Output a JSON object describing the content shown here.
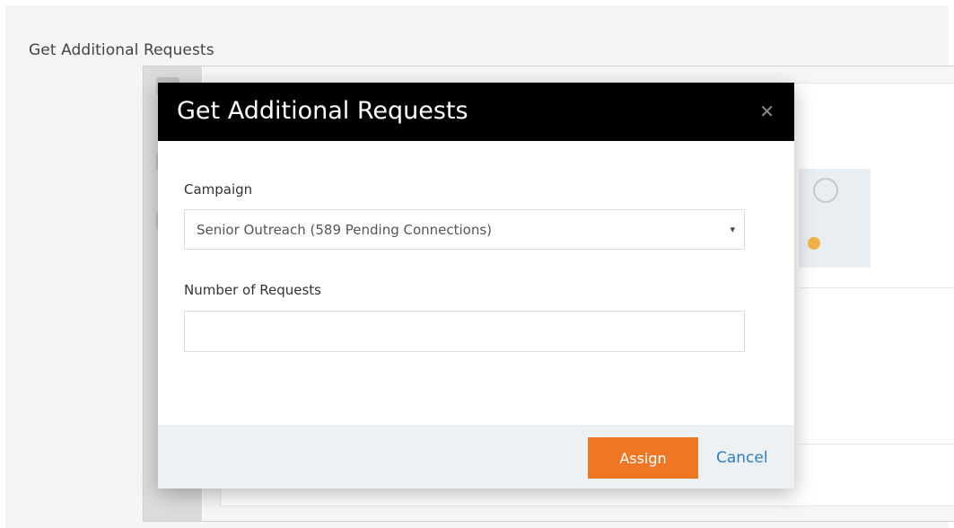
{
  "page": {
    "heading": "Get Additional Requests"
  },
  "modal": {
    "title": "Get Additional Requests",
    "close_icon": "close-icon",
    "campaign": {
      "label": "Campaign",
      "selected": "Senior Outreach (589 Pending Connections)",
      "caret_icon": "caret-down-icon"
    },
    "requests": {
      "label": "Number of Requests",
      "value": "",
      "placeholder": ""
    },
    "footer": {
      "assign_label": "Assign",
      "cancel_label": "Cancel"
    }
  },
  "colors": {
    "header_bg": "#000000",
    "assign_bg": "#ee7625",
    "cancel_link": "#2c7fc0",
    "footer_bg": "#edf1f4"
  }
}
